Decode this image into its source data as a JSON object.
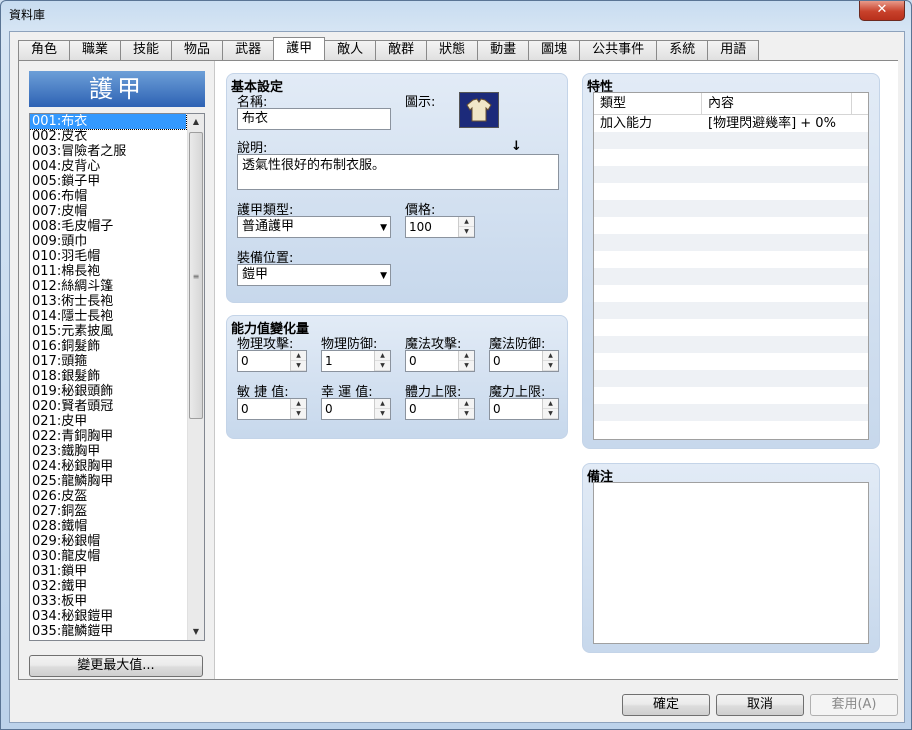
{
  "window": {
    "title": "資料庫",
    "close_label": "✕"
  },
  "tabs": [
    {
      "label": "角色"
    },
    {
      "label": "職業"
    },
    {
      "label": "技能"
    },
    {
      "label": "物品"
    },
    {
      "label": "武器"
    },
    {
      "label": "護甲",
      "active": true
    },
    {
      "label": "敵人"
    },
    {
      "label": "敵群"
    },
    {
      "label": "狀態"
    },
    {
      "label": "動畫"
    },
    {
      "label": "圖塊"
    },
    {
      "label": "公共事件"
    },
    {
      "label": "系統"
    },
    {
      "label": "用語"
    }
  ],
  "list": {
    "header": "護甲",
    "selected_index": 0,
    "items": [
      "001:布衣",
      "002:皮衣",
      "003:冒險者之服",
      "004:皮背心",
      "005:鎖子甲",
      "006:布帽",
      "007:皮帽",
      "008:毛皮帽子",
      "009:頭巾",
      "010:羽毛帽",
      "011:棉長袍",
      "012:絲綢斗篷",
      "013:術士長袍",
      "014:隱士長袍",
      "015:元素披風",
      "016:銅髮飾",
      "017:頭箍",
      "018:銀髮飾",
      "019:秘銀頭飾",
      "020:賢者頭冠",
      "021:皮甲",
      "022:青銅胸甲",
      "023:鐵胸甲",
      "024:秘銀胸甲",
      "025:龍鱗胸甲",
      "026:皮盔",
      "027:銅盔",
      "028:鐵帽",
      "029:秘銀帽",
      "030:龍皮帽",
      "031:鎖甲",
      "032:鐵甲",
      "033:板甲",
      "034:秘銀鎧甲",
      "035:龍鱗鎧甲"
    ],
    "change_max_label": "變更最大值..."
  },
  "basic": {
    "title": "基本設定",
    "name_label": "名稱:",
    "name_value": "布衣",
    "icon_label": "圖示:",
    "desc_label": "說明:",
    "desc_value": "透氣性很好的布制衣服。",
    "desc_marker": "↓",
    "armor_type_label": "護甲類型:",
    "armor_type_value": "普通護甲",
    "price_label": "價格:",
    "price_value": "100",
    "equip_label": "裝備位置:",
    "equip_value": "鎧甲"
  },
  "params": {
    "title": "能力值變化量",
    "items": [
      {
        "label": "物理攻擊:",
        "value": "0"
      },
      {
        "label": "物理防御:",
        "value": "1"
      },
      {
        "label": "魔法攻擊:",
        "value": "0"
      },
      {
        "label": "魔法防御:",
        "value": "0"
      },
      {
        "label": "敏 捷 值:",
        "value": "0"
      },
      {
        "label": "幸 運 值:",
        "value": "0"
      },
      {
        "label": "體力上限:",
        "value": "0"
      },
      {
        "label": "魔力上限:",
        "value": "0"
      }
    ]
  },
  "traits": {
    "title": "特性",
    "col_type": "類型",
    "col_content": "內容",
    "rows": [
      {
        "type": "加入能力",
        "content": "[物理閃避幾率] + 0%"
      }
    ]
  },
  "notes": {
    "title": "備注",
    "value": ""
  },
  "buttons": {
    "ok": "確定",
    "cancel": "取消",
    "apply": "套用(A)"
  },
  "icons": [
    "close-icon",
    "armor-icon",
    "dropdown-arrow-icon",
    "spin-up-icon",
    "spin-down-icon",
    "scroll-up-icon",
    "scroll-down-icon"
  ]
}
